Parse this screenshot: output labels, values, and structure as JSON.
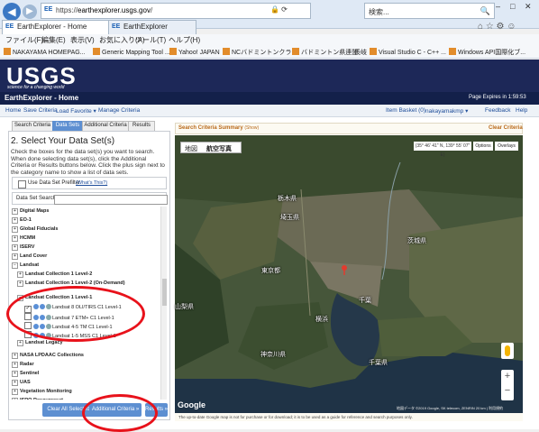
{
  "browser": {
    "url_prefix": "https://",
    "url_domain": "earthexplorer.usgs.gov",
    "url_suffix": "/",
    "address_icons": "🔒 ⟳",
    "search_placeholder": "検索...",
    "tab_active": "EarthExplorer - Home",
    "tab_inactive": "EarthExplorer",
    "tab_favicon": "EE",
    "menu": [
      "ファイル(F)",
      "編集(E)",
      "表示(V)",
      "お気に入り(A)",
      "ツール(T)",
      "ヘルプ(H)"
    ],
    "favorites": [
      "NAKAYAMA HOMEPAG...",
      "Generic Mapping Tool ...",
      "Yahoo! JAPAN",
      "NCバドミントンクラブ",
      "バドミントン県連盟",
      "長岐",
      "Visual Studio C - C++ ...",
      "Windows API国際化ブ..."
    ]
  },
  "site": {
    "logo": "USGS",
    "tagline": "science for a changing world",
    "app_title": "EarthExplorer - Home",
    "expires": "Page Expires in 1:59:53",
    "nav_links": [
      "Home",
      "Save Criteria",
      "Load Favorite ▾",
      "Manage Criteria"
    ],
    "basket": "Item Basket (0)",
    "user": "nakayamakmp ▾",
    "feedback": "Feedback",
    "help": "Help"
  },
  "criteria_tabs": [
    "Search Criteria",
    "Data Sets",
    "Additional Criteria",
    "Results"
  ],
  "left": {
    "step_title": "2. Select Your Data Set(s)",
    "instructions": "Check the boxes for the data set(s) you want to search. When done selecting data set(s), click the Additional Criteria or Results buttons below. Click the plus sign next to the category name to show a list of data sets.",
    "prefilter_label": "Use Data Set Prefilter",
    "prefilter_link": "(What's This?)",
    "search_label": "Data Set Search:",
    "tree": [
      {
        "label": "Digital Maps",
        "sign": "+"
      },
      {
        "label": "EO-1",
        "sign": "+"
      },
      {
        "label": "Global Fiducials",
        "sign": "+"
      },
      {
        "label": "HCMM",
        "sign": "+"
      },
      {
        "label": "ISERV",
        "sign": "+"
      },
      {
        "label": "Land Cover",
        "sign": "+"
      },
      {
        "label": "Landsat",
        "sign": "−"
      },
      {
        "label": "Landsat Collection 1 Level-2",
        "sign": "+"
      },
      {
        "label": "Landsat Collection 1 Level-2 (On-Demand)",
        "sign": "+"
      },
      {
        "label": "Landsat Collection 1 Level-1",
        "sign": "−"
      },
      {
        "label": "Landsat 8 OLI/TIRS C1 Level-1",
        "checked": true
      },
      {
        "label": "Landsat 7 ETM+ C1 Level-1",
        "checked": false
      },
      {
        "label": "Landsat 4-5 TM C1 Level-1",
        "checked": false
      },
      {
        "label": "Landsat 1-5 MSS C1 Level-1",
        "checked": false
      },
      {
        "label": "Landsat Legacy",
        "sign": "+"
      },
      {
        "label": "NASA LPDAAC Collections",
        "sign": "+"
      },
      {
        "label": "Radar",
        "sign": "+"
      },
      {
        "label": "Sentinel",
        "sign": "+"
      },
      {
        "label": "UAS",
        "sign": "+"
      },
      {
        "label": "Vegetation Monitoring",
        "sign": "+"
      },
      {
        "label": "ISRO Resourcesat",
        "sign": "+"
      }
    ],
    "btn_clear": "Clear All Selected",
    "btn_additional": "Additional Criteria »",
    "btn_results": "Results »"
  },
  "map": {
    "summary_title": "Search Criteria Summary",
    "summary_state": "(Show)",
    "clear": "Clear Criteria",
    "type_map": "地図",
    "type_sat": "航空写真",
    "coord": "(35° 46' 41\" N, 139° 55' 07\" E)",
    "options": "Options",
    "overlays": "Overlays",
    "labels": [
      "栃木県",
      "埼玉県",
      "東京都",
      "千葉県",
      "山梨県",
      "神奈川県",
      "茨城県",
      "千葉",
      "横浜"
    ],
    "google": "Google",
    "attribution": "地図データ ©2019 Google, SK telecom, ZENRIN 20 km | 利用規約",
    "disclaimer": "The up-to-date Google map is not for purchase or for download; it is to be used as a guide for reference and search purposes only."
  },
  "colors": {
    "header": "#1d2858",
    "accent": "#5d8fd1",
    "annotation": "#e8121b"
  }
}
